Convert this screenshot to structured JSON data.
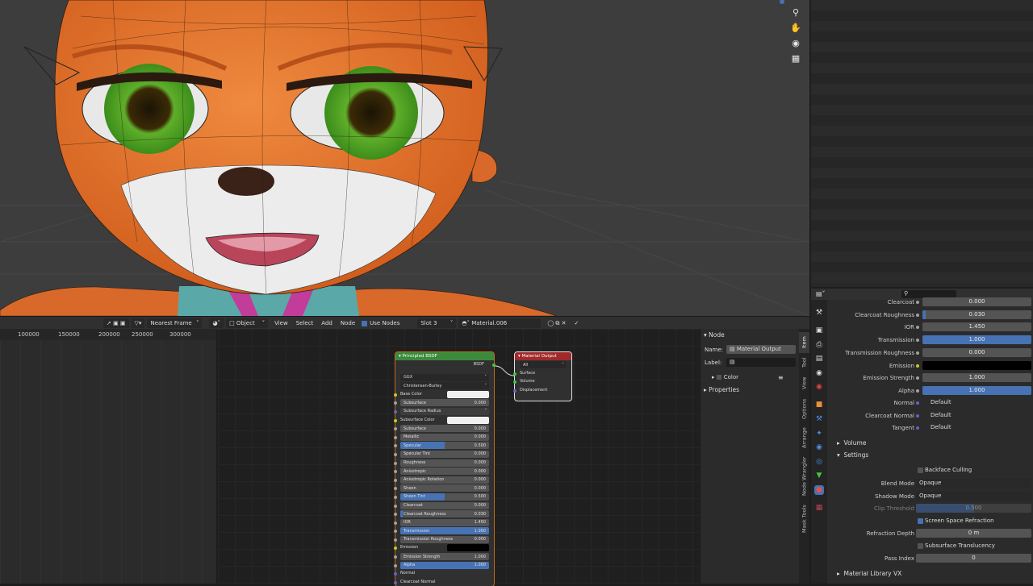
{
  "colors": {
    "accent": "#4772b3",
    "bsdf_header": "#3c8a3c",
    "output_header": "#a02a2a",
    "socket_yellow": "#c7c729",
    "socket_gray": "#a1a1a1",
    "socket_purple": "#6363c7",
    "socket_green": "#3fc73f"
  },
  "viewport": {
    "tools": [
      "zoom-icon",
      "hand-icon",
      "camera-icon",
      "grid-icon"
    ]
  },
  "node_header": {
    "frame_mode": "Nearest Frame",
    "object_mode": "Object",
    "menus": [
      "View",
      "Select",
      "Add",
      "Node"
    ],
    "use_nodes": "Use Nodes",
    "slot": "Slot 3",
    "material": "Material.006"
  },
  "timeline": {
    "ruler": [
      "100000",
      "150000",
      "200000",
      "250000",
      "300000"
    ]
  },
  "bsdf": {
    "title": "Principled BSDF",
    "output": "BSDF",
    "distribution": "GGX",
    "subsurface_method": "Christensen-Burley",
    "base_color": "Base Color",
    "subsurface_radius": "Subsurface Radius",
    "subsurface_color": "Subsurface Color",
    "fields": [
      {
        "k": "subsurface",
        "label": "Subsurface",
        "value": "0.000",
        "fill": 0
      },
      {
        "k": "metallic",
        "label": "Metallic",
        "value": "0.000",
        "fill": 0
      },
      {
        "k": "specular",
        "label": "Specular",
        "value": "0.500",
        "fill": 0.5
      },
      {
        "k": "specular_tint",
        "label": "Specular Tint",
        "value": "0.000",
        "fill": 0
      },
      {
        "k": "roughness",
        "label": "Roughness",
        "value": "0.000",
        "fill": 0
      },
      {
        "k": "anisotropic",
        "label": "Anisotropic",
        "value": "0.000",
        "fill": 0
      },
      {
        "k": "anisotropic_rotation",
        "label": "Anisotropic Rotation",
        "value": "0.000",
        "fill": 0
      },
      {
        "k": "sheen",
        "label": "Sheen",
        "value": "0.000",
        "fill": 0
      },
      {
        "k": "sheen_tint",
        "label": "Sheen Tint",
        "value": "0.500",
        "fill": 0.5
      },
      {
        "k": "clearcoat",
        "label": "Clearcoat",
        "value": "0.000",
        "fill": 0
      },
      {
        "k": "clearcoat_roughness",
        "label": "Clearcoat Roughness",
        "value": "0.030",
        "fill": 0.03
      },
      {
        "k": "ior",
        "label": "IOR",
        "value": "1.450",
        "fill": 0
      },
      {
        "k": "transmission",
        "label": "Transmission",
        "value": "1.000",
        "fill": 1
      },
      {
        "k": "transmission_roughness",
        "label": "Transmission Roughness",
        "value": "0.000",
        "fill": 0
      }
    ],
    "emission": "Emission",
    "emission_strength": {
      "label": "Emission Strength",
      "value": "1.000"
    },
    "alpha": {
      "label": "Alpha",
      "value": "1.000"
    },
    "normal": "Normal",
    "clearcoat_normal": "Clearcoat Normal"
  },
  "output_node": {
    "title": "Material Output",
    "target": "All",
    "inputs": [
      "Surface",
      "Volume",
      "Displacement"
    ]
  },
  "npanel": {
    "section": "Node",
    "name_label": "Name:",
    "name_value": "Material Output",
    "label_label": "Label:",
    "color": "Color",
    "properties": "Properties",
    "tabs": [
      "Item",
      "Tool",
      "View",
      "Options",
      "Arrange",
      "Node Wrangler",
      "Mask Tools"
    ]
  },
  "props": {
    "rows": [
      {
        "label": "Clearcoat",
        "value": "0.000",
        "fill": 0
      },
      {
        "label": "Clearcoat Roughness",
        "value": "0.030",
        "fill": 0.03
      },
      {
        "label": "IOR",
        "value": "1.450",
        "fill": 0
      },
      {
        "label": "Transmission",
        "value": "1.000",
        "fill": 1
      },
      {
        "label": "Transmission Roughness",
        "value": "0.000",
        "fill": 0
      },
      {
        "label": "Emission",
        "value": "",
        "fill": 0,
        "color": "#000000"
      },
      {
        "label": "Emission Strength",
        "value": "1.000",
        "fill": 0
      },
      {
        "label": "Alpha",
        "value": "1.000",
        "fill": 1
      }
    ],
    "links": [
      {
        "label": "Normal",
        "value": "Default"
      },
      {
        "label": "Clearcoat Normal",
        "value": "Default"
      },
      {
        "label": "Tangent",
        "value": "Default"
      }
    ],
    "volume": "Volume",
    "settings": "Settings",
    "backface_culling": "Backface Culling",
    "blend_mode": {
      "label": "Blend Mode",
      "value": "Opaque"
    },
    "shadow_mode": {
      "label": "Shadow Mode",
      "value": "Opaque"
    },
    "clip_threshold": {
      "label": "Clip Threshold",
      "value": "0.500"
    },
    "ssr": "Screen Space Refraction",
    "refraction_depth": {
      "label": "Refraction Depth",
      "value": "0 m"
    },
    "subsurface_translucency": "Subsurface Translucency",
    "pass_index": {
      "label": "Pass Index",
      "value": "0"
    },
    "material_library": "Material Library VX"
  }
}
